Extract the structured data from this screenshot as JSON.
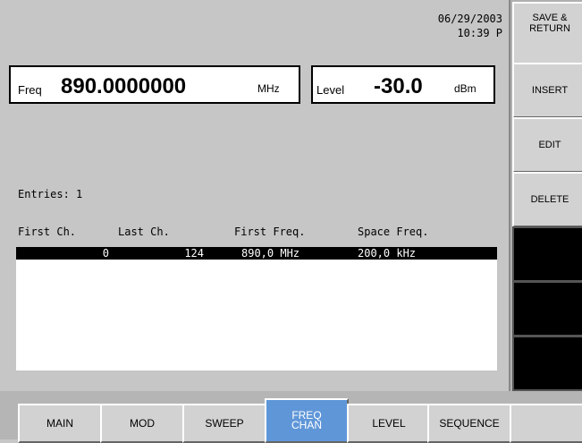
{
  "status": {
    "date": "06/29/2003",
    "time": "10:39 P"
  },
  "freq": {
    "label": "Freq",
    "value": "890.0000000",
    "unit": "MHz"
  },
  "level": {
    "label": "Level",
    "value": "-30.0",
    "unit": "dBm"
  },
  "entries_label": "Entries: 1",
  "table": {
    "columns": [
      "First Ch.",
      "Last Ch.",
      "First Freq.",
      "Space Freq."
    ],
    "rows": [
      {
        "first_ch": "0",
        "last_ch": "124",
        "first_freq": "890,0 MHz",
        "space_freq": "200,0 kHz",
        "selected": true
      }
    ]
  },
  "softkeys": [
    "SAVE &\nRETURN",
    "INSERT",
    "EDIT",
    "DELETE",
    "",
    "",
    ""
  ],
  "menu": {
    "active": "FREQ\nCHAN",
    "items": [
      "MAIN",
      "MOD",
      "SWEEP",
      "FREQ\nCHAN",
      "LEVEL",
      "SEQUENCE",
      ""
    ]
  },
  "colors": {
    "background": "#c6c6c6",
    "active_tab": "#5f96d8",
    "selection": "#000000"
  }
}
